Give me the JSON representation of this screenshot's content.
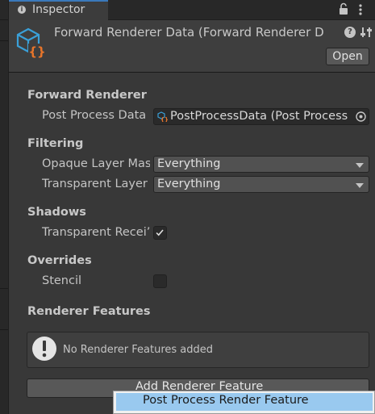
{
  "tab": {
    "title": "Inspector"
  },
  "header": {
    "title": "Forward Renderer Data (Forward Renderer D",
    "open_label": "Open"
  },
  "sections": {
    "forward_renderer": {
      "title": "Forward Renderer",
      "post_process_label": "Post Process Data",
      "post_process_value": "PostProcessData (Post Process"
    },
    "filtering": {
      "title": "Filtering",
      "opaque_label": "Opaque Layer Mas",
      "opaque_value": "Everything",
      "transparent_label": "Transparent Layer",
      "transparent_value": "Everything"
    },
    "shadows": {
      "title": "Shadows",
      "transparent_receive_label": "Transparent Recei’",
      "transparent_receive_checked": true
    },
    "overrides": {
      "title": "Overrides",
      "stencil_label": "Stencil",
      "stencil_checked": false
    },
    "renderer_features": {
      "title": "Renderer Features",
      "empty_message": "No Renderer Features added",
      "add_label": "Add Renderer Feature"
    }
  },
  "popup": {
    "items": [
      "Post Process Render Feature"
    ]
  },
  "colors": {
    "background": "#383838",
    "accent_tab": "#3a79bb",
    "asset_icon": "#3aa0d8",
    "asset_braces": "#e8752a",
    "popup_highlight": "#99c9ef"
  },
  "icons": [
    "info-icon",
    "lock-icon",
    "kebab-menu-icon",
    "renderer-asset-icon",
    "help-icon",
    "settings-sliders-icon",
    "object-picker-icon",
    "warning-icon",
    "checkmark-icon"
  ]
}
